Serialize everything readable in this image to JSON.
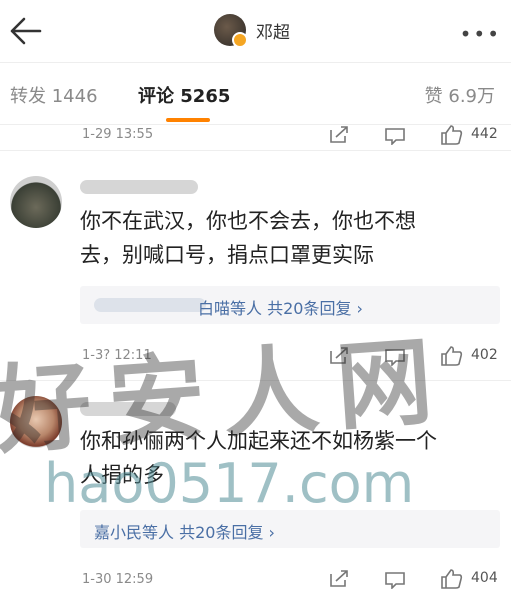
{
  "header": {
    "username": "邓超",
    "back_icon": "back-arrow-icon",
    "more_icon": "more-dots-icon"
  },
  "tabs": {
    "repost": "转发 1446",
    "comment": "评论 5265",
    "like": "赞 6.9万"
  },
  "first_row": {
    "time": "1-29 13:55",
    "likes": "442"
  },
  "comments": [
    {
      "text_line1": "你不在武汉，你也不会去，你也不想",
      "text_line2": "去，别喊口号，捐点口罩更实际",
      "reply_link": "白喵等人 共20条回复 ›",
      "time": "1-3? 12:11",
      "likes": "402"
    },
    {
      "text_line1": "你和孙俪两个人加起来还不如杨紫一个",
      "text_line2": "人捐的多",
      "reply_link": "嘉小民等人 共20条回复 ›",
      "time": "1-30 12:59",
      "likes": "404"
    }
  ],
  "watermark": {
    "cn": "好安人网",
    "url": "hao0517.com"
  },
  "colors": {
    "accent": "#ff8200",
    "link": "#4a6fa5",
    "muted": "#8a8a8a"
  }
}
